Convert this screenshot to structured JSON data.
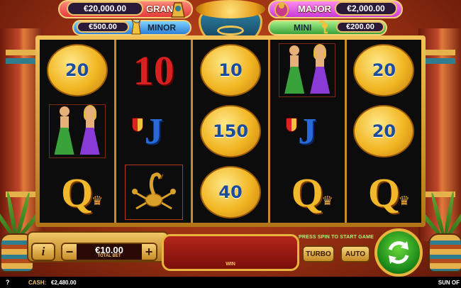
{
  "jackpots": {
    "grand": {
      "label": "GRAND",
      "amount": "€20,000.00"
    },
    "major": {
      "label": "MAJOR",
      "amount": "€2,000.00"
    },
    "minor": {
      "label": "MINOR",
      "amount": "€500.00"
    },
    "mini": {
      "label": "MINI",
      "amount": "€200.00"
    }
  },
  "reels": [
    [
      {
        "type": "coin",
        "value": "20"
      },
      {
        "type": "dancers",
        "icon": "dancers-icon"
      },
      {
        "type": "royal",
        "value": "Q"
      }
    ],
    [
      {
        "type": "royal",
        "value": "10"
      },
      {
        "type": "royal",
        "value": "J"
      },
      {
        "type": "scorpion",
        "icon": "scorpion-icon"
      }
    ],
    [
      {
        "type": "coin",
        "value": "10"
      },
      {
        "type": "coin",
        "value": "150"
      },
      {
        "type": "coin",
        "value": "40"
      }
    ],
    [
      {
        "type": "dancers",
        "icon": "dancers-icon"
      },
      {
        "type": "royal",
        "value": "J"
      },
      {
        "type": "royal",
        "value": "Q"
      }
    ],
    [
      {
        "type": "coin",
        "value": "20"
      },
      {
        "type": "coin",
        "value": "20"
      },
      {
        "type": "royal",
        "value": "Q"
      }
    ]
  ],
  "controls": {
    "info": "i",
    "minus": "−",
    "plus": "+",
    "bet_value": "€10.00",
    "bet_label": "TOTAL BET",
    "win_label": "WIN",
    "hint": "PRESS SPIN TO START GAME",
    "turbo": "TURBO",
    "auto": "AUTO",
    "spin_icon": "spin-arrows-icon"
  },
  "footer": {
    "help": "?",
    "cash_label": "CASH:",
    "cash_value": "€2,480.00",
    "title": "SUN OF"
  },
  "colors": {
    "coin_text": "#1b4d9c",
    "grand": "#e33a3a",
    "major": "#c83ad6",
    "minor": "#2e7fd6",
    "mini": "#3aa23a",
    "hint": "#aef27a"
  }
}
